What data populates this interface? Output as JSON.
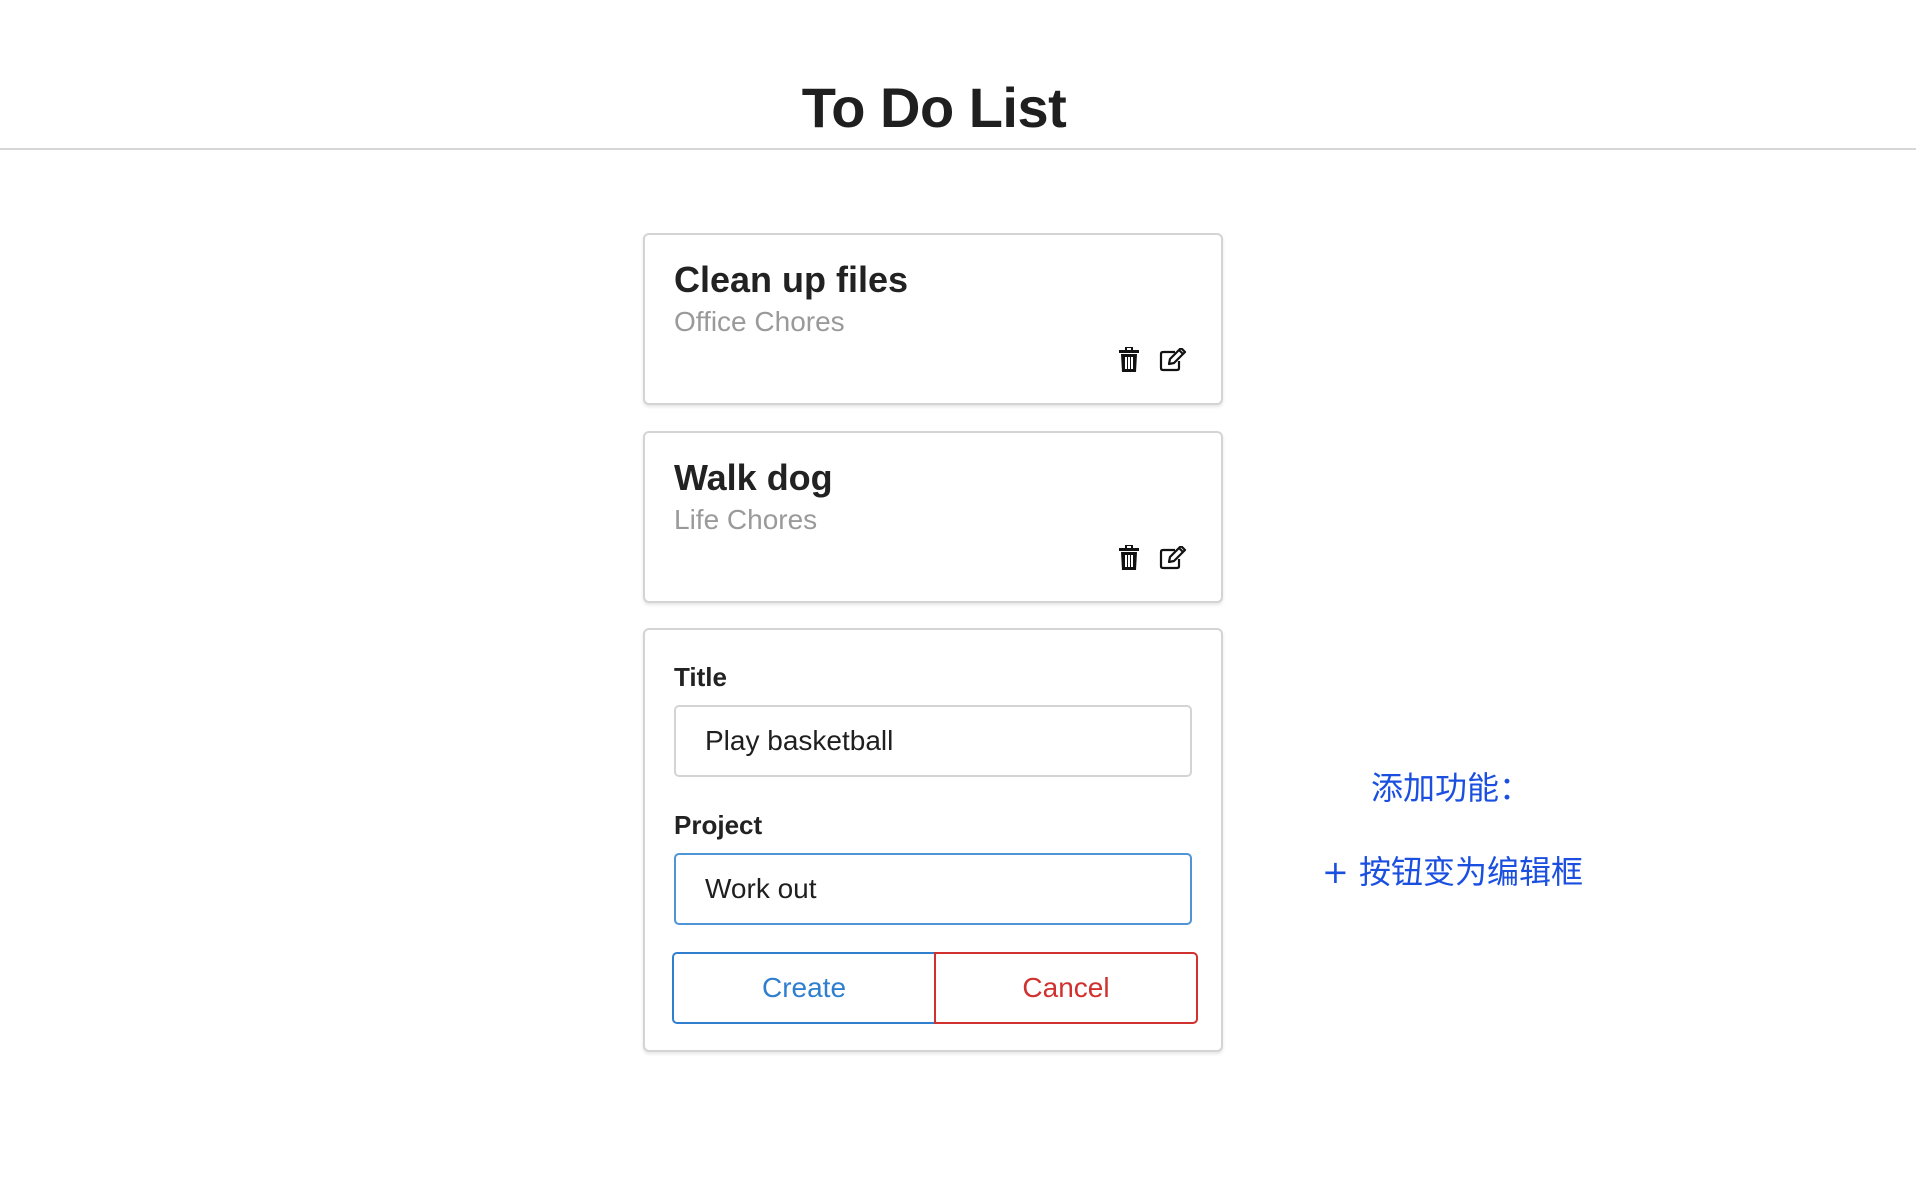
{
  "header": {
    "title": "To Do List"
  },
  "todos": [
    {
      "title": "Clean up files",
      "project": "Office Chores",
      "actions": {
        "delete_icon": "trash-icon",
        "edit_icon": "edit-icon"
      }
    },
    {
      "title": "Walk dog",
      "project": "Life Chores",
      "actions": {
        "delete_icon": "trash-icon",
        "edit_icon": "edit-icon"
      }
    }
  ],
  "form": {
    "title_label": "Title",
    "title_value": "Play basketball",
    "project_label": "Project",
    "project_value": "Work out",
    "create_label": "Create",
    "cancel_label": "Cancel"
  },
  "annotations": {
    "line1": "添加功能：",
    "line2": "+ 按钮变为编辑框"
  },
  "colors": {
    "create_accent": "#2f7fce",
    "cancel_accent": "#d0302e",
    "annotation": "#1a4fe0",
    "subtitle_gray": "#9a9a9a",
    "focus_border": "#4f94d4"
  }
}
